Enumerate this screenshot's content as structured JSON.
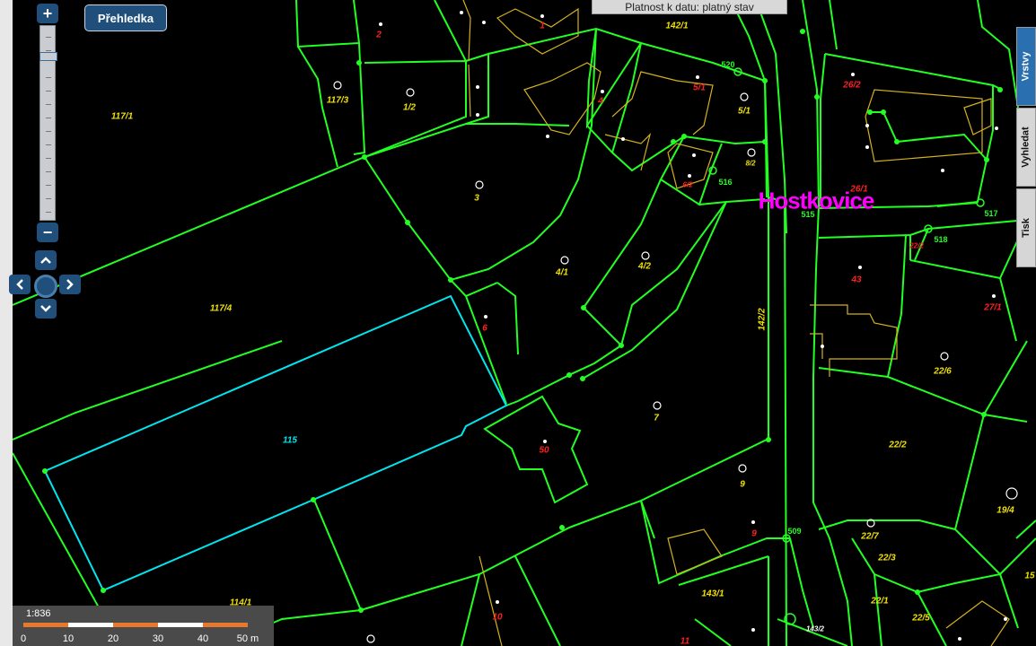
{
  "toolbar": {
    "overview_label": "Přehledka"
  },
  "status_bar": {
    "validity": "Platnost k datu: platný stav"
  },
  "zoom": {
    "plus": "+",
    "minus": "−",
    "level": 0.14
  },
  "pan": {
    "up": "⌃",
    "down": "⌄",
    "left": "‹",
    "right": "›"
  },
  "side_tabs": [
    {
      "label": "Vrstvy",
      "active": true
    },
    {
      "label": "Vyhledat",
      "active": false
    },
    {
      "label": "Tisk",
      "active": false
    }
  ],
  "scale": {
    "ratio": "1:836",
    "ticks": [
      "0",
      "10",
      "20",
      "30",
      "40",
      "50 m"
    ],
    "colors": [
      "#e8782e",
      "#ffffff"
    ]
  },
  "place_name": "Hostkovice",
  "colors": {
    "parcel_line": "#22ff22",
    "building_line": "#d4b020",
    "selected_parcel": "#00e5ee",
    "parcel_label": "#f0e000",
    "building_label": "#ff2020",
    "place_name": "#ff00ff"
  },
  "labels": {
    "parcels": [
      "117/1",
      "117/3",
      "1/2",
      "3",
      "117/4",
      "4/1",
      "4/2",
      "142/1",
      "5/1",
      "8/2",
      "142/2",
      "7",
      "9",
      "143/1",
      "114/1",
      "22/6",
      "22/2",
      "19/4",
      "22/7",
      "22/3",
      "22/1",
      "22/5",
      "27/1",
      "15"
    ],
    "buildings": [
      "2",
      "1",
      "4",
      "5/1",
      "6/2",
      "26/2",
      "26/1",
      "22/2",
      "43",
      "6",
      "50",
      "9",
      "10",
      "11"
    ],
    "selected": "115",
    "points": [
      "520",
      "516",
      "515",
      "517",
      "518",
      "509",
      "143/2"
    ]
  }
}
